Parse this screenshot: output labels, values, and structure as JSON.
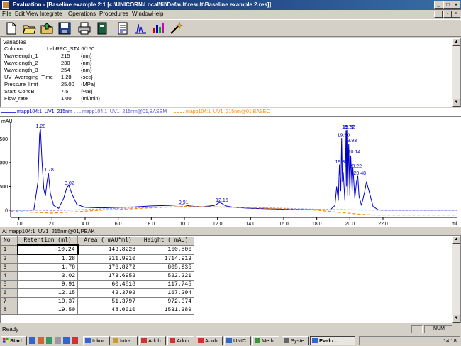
{
  "window": {
    "title": "Evaluation - [Baseline example 2:1    [c:\\UNICORN\\Local\\fil\\Default\\result\\Baseline example 2.res]]"
  },
  "menu": [
    "File",
    "Edit",
    "View",
    "Integrate",
    "Operations",
    "Procedures",
    "Window",
    "Help"
  ],
  "toolbar": [
    "new-icon",
    "open-icon",
    "open-folder-icon",
    "save-icon",
    "print-icon",
    "notebook-icon",
    "report-icon",
    "chromatogram-icon",
    "peak-table-icon",
    "magic-wand-icon"
  ],
  "variables": {
    "header": "Variables",
    "rows": [
      {
        "key": "Column",
        "value": "LabRPC_ST4.6/150",
        "unit": ""
      },
      {
        "key": "Wavelength_1",
        "value": "215",
        "unit": "{nm}"
      },
      {
        "key": "Wavelength_2",
        "value": "230",
        "unit": "{nm}"
      },
      {
        "key": "Wavelength_3",
        "value": "254",
        "unit": "{nm}"
      },
      {
        "key": "UV_Averaging_Time",
        "value": "1.28",
        "unit": "{sec}"
      },
      {
        "key": "Pressure_limit",
        "value": "25.00",
        "unit": "{MPa}"
      },
      {
        "key": "Start_ConcB",
        "value": "7.5",
        "unit": "{%B}"
      },
      {
        "key": "Flow_rate",
        "value": "1.00",
        "unit": "{ml/min}"
      }
    ]
  },
  "legend": {
    "s1": "mapp104:1_UV1_215nm",
    "s2": "mapp104:1_UV1_215nm@01,BASEM",
    "s3": "mapp104:1_UV1_215nm@01,BASEC"
  },
  "chart_data": {
    "type": "line",
    "ylabel": "mAU",
    "xlabel": "ml",
    "ylim": [
      -150,
      1850
    ],
    "xlim": [
      -0.5,
      26.5
    ],
    "yticks": [
      0,
      500,
      1000,
      1500
    ],
    "xticks": [
      0.0,
      2.0,
      4.0,
      6.0,
      8.0,
      10.0,
      12.0,
      14.0,
      16.0,
      18.0,
      20.0,
      22.0
    ],
    "peak_labels": [
      {
        "x": 1.28,
        "y": 1715,
        "text": "1.28"
      },
      {
        "x": 1.78,
        "y": 806,
        "text": "1.78"
      },
      {
        "x": 3.02,
        "y": 522,
        "text": "3.02"
      },
      {
        "x": 9.91,
        "y": 118,
        "text": "9.91"
      },
      {
        "x": 12.15,
        "y": 167,
        "text": "12.15"
      },
      {
        "x": 19.37,
        "y": 972,
        "text": "19.37"
      },
      {
        "x": 19.5,
        "y": 1531,
        "text": "19.50"
      },
      {
        "x": 19.77,
        "y": 1700,
        "text": "19.77"
      },
      {
        "x": 19.82,
        "y": 1700,
        "text": "19.82"
      },
      {
        "x": 19.93,
        "y": 1420,
        "text": "19.93"
      },
      {
        "x": 20.14,
        "y": 1180,
        "text": "20.14"
      },
      {
        "x": 20.22,
        "y": 880,
        "text": "20.22"
      },
      {
        "x": 20.48,
        "y": 730,
        "text": "20.48"
      }
    ],
    "series": [
      {
        "name": "mapp104:1_UV1_215nm",
        "color": "#0000cc",
        "x": [
          -0.5,
          0.9,
          1.15,
          1.25,
          1.3,
          1.4,
          1.5,
          1.6,
          1.7,
          1.78,
          1.9,
          2.1,
          2.4,
          2.7,
          2.9,
          3.02,
          3.2,
          3.5,
          4.0,
          5.0,
          6.0,
          7.0,
          8.0,
          9.0,
          9.5,
          9.91,
          10.3,
          11.0,
          11.8,
          12.15,
          12.5,
          13.0,
          14.0,
          15.0,
          16.0,
          17.0,
          18.0,
          18.8,
          19.1,
          19.2,
          19.3,
          19.37,
          19.45,
          19.5,
          19.55,
          19.6,
          19.7,
          19.77,
          19.8,
          19.82,
          19.87,
          19.93,
          20.0,
          20.05,
          20.14,
          20.18,
          20.22,
          20.3,
          20.4,
          20.48,
          20.55,
          20.7,
          20.9,
          21.0,
          21.2,
          21.4,
          21.7,
          22.0,
          26.5
        ],
        "y": [
          0,
          0,
          600,
          1600,
          1715,
          1000,
          450,
          300,
          600,
          780,
          350,
          100,
          40,
          250,
          480,
          522,
          350,
          120,
          60,
          50,
          60,
          70,
          90,
          100,
          110,
          118,
          90,
          70,
          100,
          167,
          90,
          60,
          40,
          30,
          20,
          15,
          10,
          5,
          100,
          500,
          200,
          960,
          400,
          1520,
          600,
          800,
          200,
          1680,
          500,
          1690,
          300,
          1400,
          300,
          1150,
          400,
          900,
          700,
          250,
          600,
          720,
          300,
          100,
          400,
          600,
          350,
          80,
          10,
          0,
          0
        ]
      },
      {
        "name": "mapp104:1_UV1_215nm@01,BASEM",
        "color": "#9999ff",
        "x": [
          -0.5,
          1.2,
          2.0,
          6.0,
          10.0,
          14.0,
          18.0,
          20.0,
          21.0,
          22.0,
          26.5
        ],
        "y": [
          0,
          0,
          -10,
          40,
          80,
          60,
          20,
          10,
          5,
          0,
          0
        ]
      },
      {
        "name": "mapp104:1_UV1_215nm@01,BASEC",
        "color": "#ff8800",
        "x": [
          -0.5,
          2.0,
          5.0,
          8.0,
          10.0,
          12.0,
          14.0,
          16.0,
          18.0,
          19.5,
          20.5,
          21.5,
          26.5
        ],
        "y": [
          -20,
          -60,
          0,
          50,
          80,
          70,
          50,
          30,
          0,
          -50,
          -80,
          -100,
          -100
        ]
      }
    ]
  },
  "table": {
    "title": "A: mapp104:1_UV1_215nm@01,PEAK",
    "headers": [
      "No",
      "Retention (ml)",
      "Area ( mAU*ml)",
      "Height ( mAU)"
    ],
    "rows": [
      [
        "1",
        "-10.24",
        "143.8228",
        "160.806"
      ],
      [
        "2",
        "1.28",
        "311.9910",
        "1714.913"
      ],
      [
        "3",
        "1.78",
        "176.8272",
        "805.935"
      ],
      [
        "4",
        "3.02",
        "173.6952",
        "522.221"
      ],
      [
        "5",
        "9.91",
        "60.4818",
        "117.745"
      ],
      [
        "6",
        "12.15",
        "42.3792",
        "167.204"
      ],
      [
        "7",
        "19.37",
        "51.3797",
        "972.374"
      ],
      [
        "8",
        "19.50",
        "48.0010",
        "1531.389"
      ]
    ]
  },
  "status": {
    "left": "Ready",
    "num": "NUM"
  },
  "taskbar": {
    "start": "Start",
    "tasks": [
      "Inkor...",
      "Intra...",
      "Adob...",
      "Adob...",
      "Adob...",
      "UNIC...",
      "Meth...",
      "Syste...",
      "Evalu..."
    ],
    "clock": "14:18"
  }
}
